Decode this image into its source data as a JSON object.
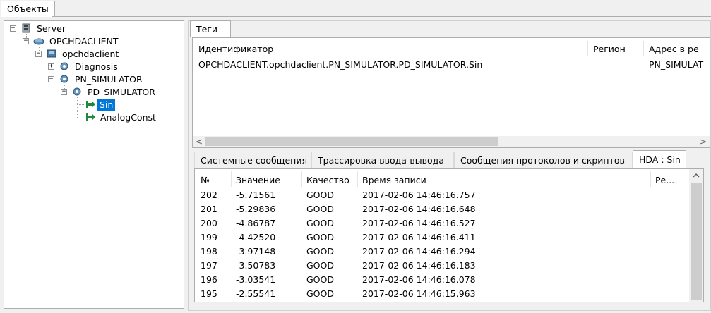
{
  "top_tab": {
    "label": "Объекты"
  },
  "tree": {
    "nodes": [
      {
        "label": "Server"
      },
      {
        "label": "OPCHDACLIENT"
      },
      {
        "label": "opchdaclient"
      },
      {
        "label": "Diagnosis"
      },
      {
        "label": "PN_SIMULATOR"
      },
      {
        "label": "PD_SIMULATOR"
      },
      {
        "label": "Sin",
        "selected": true
      },
      {
        "label": "AnalogConst"
      }
    ]
  },
  "tags_tab": {
    "label": "Теги"
  },
  "tags_table": {
    "columns": [
      "Идентификатор",
      "Регион",
      "Адрес в ре"
    ],
    "rows": [
      {
        "id": "OPCHDACLIENT.opchdaclient.PN_SIMULATOR.PD_SIMULATOR.Sin",
        "region": "",
        "address": "PN_SIMULAT"
      }
    ],
    "hscroll_left": "<",
    "hscroll_right": ">"
  },
  "bottom_tabs": [
    {
      "label": "Системные сообщения",
      "active": false
    },
    {
      "label": "Трассировка ввода-вывода",
      "active": false
    },
    {
      "label": "Сообщения протоколов и скриптов",
      "active": false
    },
    {
      "label": "HDA : Sin",
      "active": true
    }
  ],
  "hda_table": {
    "columns": [
      "№",
      "Значение",
      "Качество",
      "Время записи",
      "Ре..."
    ],
    "rows": [
      {
        "num": "202",
        "value": "-5.71561",
        "quality": "GOOD",
        "time": "2017-02-06 14:46:16.757"
      },
      {
        "num": "201",
        "value": "-5.29836",
        "quality": "GOOD",
        "time": "2017-02-06 14:46:16.648"
      },
      {
        "num": "200",
        "value": "-4.86787",
        "quality": "GOOD",
        "time": "2017-02-06 14:46:16.527"
      },
      {
        "num": "199",
        "value": "-4.42520",
        "quality": "GOOD",
        "time": "2017-02-06 14:46:16.411"
      },
      {
        "num": "198",
        "value": "-3.97148",
        "quality": "GOOD",
        "time": "2017-02-06 14:46:16.294"
      },
      {
        "num": "197",
        "value": "-3.50783",
        "quality": "GOOD",
        "time": "2017-02-06 14:46:16.183"
      },
      {
        "num": "196",
        "value": "-3.03541",
        "quality": "GOOD",
        "time": "2017-02-06 14:46:16.078"
      },
      {
        "num": "195",
        "value": "-2.55541",
        "quality": "GOOD",
        "time": "2017-02-06 14:46:15.963"
      }
    ]
  },
  "colors": {
    "selection": "#0078d7",
    "border": "#adadad",
    "background": "#f0f0f0"
  }
}
